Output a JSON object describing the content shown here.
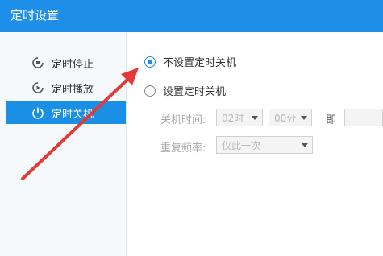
{
  "window": {
    "title": "定时设置"
  },
  "sidebar": {
    "items": [
      {
        "label": "定时停止",
        "icon": "timer-stop-icon",
        "active": false
      },
      {
        "label": "定时播放",
        "icon": "timer-play-icon",
        "active": false
      },
      {
        "label": "定时关机",
        "icon": "power-icon",
        "active": true
      }
    ]
  },
  "options": {
    "no_shutdown_label": "不设置定时关机",
    "set_shutdown_label": "设置定时关机",
    "selected": "no_shutdown"
  },
  "shutdown_time": {
    "label": "关机时间:",
    "hour_value": "02时",
    "minute_value": "00分",
    "immediately_label": "即"
  },
  "repeat": {
    "label": "重复频率:",
    "value": "仅此一次"
  },
  "colors": {
    "accent": "#1a8fe6",
    "annotation_arrow": "#e53935"
  }
}
